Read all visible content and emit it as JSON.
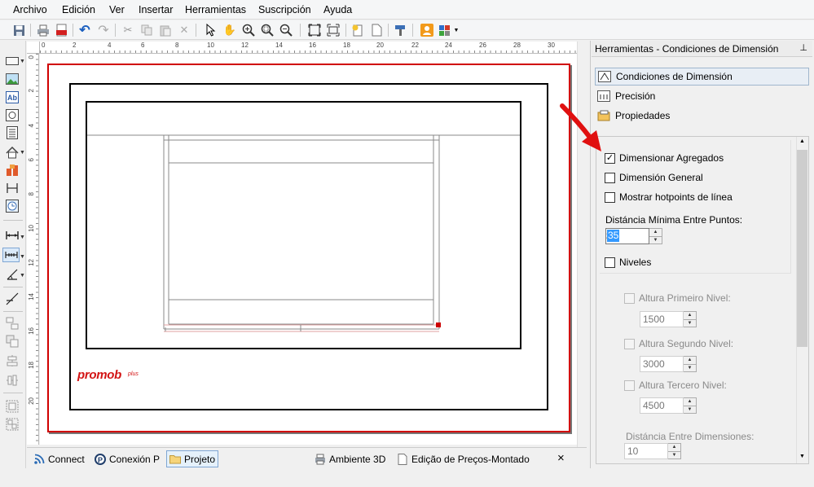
{
  "menu": [
    "Archivo",
    "Edición",
    "Ver",
    "Insertar",
    "Herramientas",
    "Suscripción",
    "Ayuda"
  ],
  "ruler": {
    "horizontal": [
      "0",
      "2",
      "4",
      "6",
      "8",
      "10",
      "12",
      "14",
      "16",
      "18",
      "20",
      "22",
      "24",
      "26",
      "28",
      "30"
    ],
    "vertical": [
      "0",
      "2",
      "4",
      "6",
      "8",
      "10",
      "12",
      "14",
      "16",
      "18",
      "20"
    ]
  },
  "canvas": {
    "logo": "promob",
    "logo_sub": "plus"
  },
  "bottom_tabs": [
    "Connect",
    "Conexión P",
    "Projeto",
    "Ambiente 3D",
    "Edição de Preços-Montado"
  ],
  "bottom_close": "×",
  "panel": {
    "title": "Herramientas - Condiciones de Dimensión",
    "pin": "⊥",
    "tabs": [
      "Condiciones de Dimensión",
      "Precisión",
      "Propiedades"
    ],
    "options": {
      "dimensionar_agregados": "Dimensionar Agregados",
      "dimension_general": "Dimensión General",
      "mostrar_hotpoints": "Mostrar hotpoints de línea",
      "distancia_minima_label": "Distáncia Mínima Entre Puntos:",
      "distancia_minima_value": "35",
      "niveles": "Niveles",
      "altura_primeiro": "Altura Primeiro Nivel:",
      "altura_primeiro_value": "1500",
      "altura_segundo": "Altura Segundo Nivel:",
      "altura_segundo_value": "3000",
      "altura_tercero": "Altura Tercero Nivel:",
      "altura_tercero_value": "4500",
      "distancia_dimensiones_label": "Distáncia Entre Dimensiones:",
      "distancia_dimensiones_value": "10"
    }
  },
  "colors": {
    "page_border": "#d00000",
    "logo": "#d31414",
    "annotation_arrow": "#e01010",
    "selection": "#3399ff"
  }
}
